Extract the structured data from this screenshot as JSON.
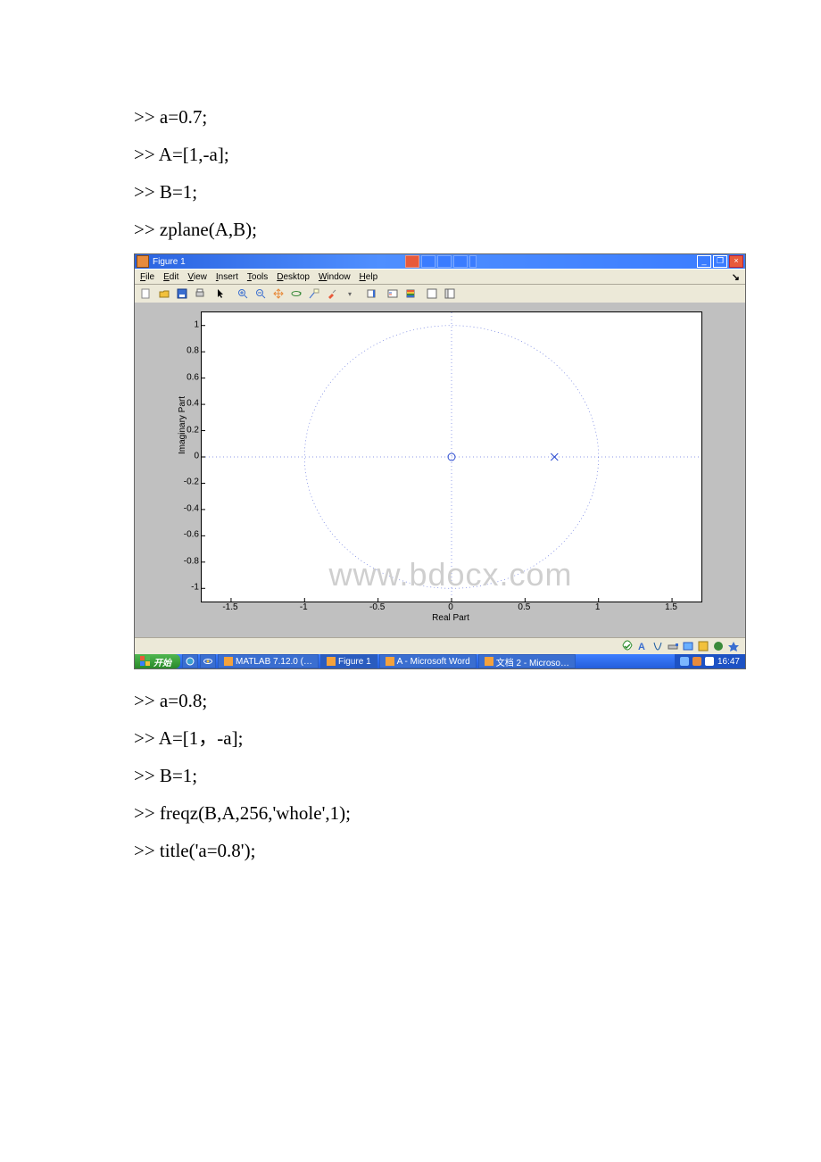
{
  "code_before": [
    ">> a=0.7;",
    ">> A=[1,-a];",
    ">> B=1;",
    ">> zplane(A,B);"
  ],
  "code_after": [
    ">> a=0.8;",
    ">> A=[1，-a];",
    ">> B=1;",
    ">> freqz(B,A,256,'whole',1);",
    ">> title('a=0.8');"
  ],
  "window": {
    "title": "Figure 1",
    "menus": [
      "File",
      "Edit",
      "View",
      "Insert",
      "Tools",
      "Desktop",
      "Window",
      "Help"
    ],
    "close_x": "×"
  },
  "taskbar": {
    "start": "开始",
    "items": [
      {
        "label": "MATLAB 7.12.0 (…"
      },
      {
        "label": "Figure 1",
        "active": true
      },
      {
        "label": "A - Microsoft Word"
      },
      {
        "label": "文档 2 - Microso…"
      }
    ],
    "clock": "16:47"
  },
  "watermark": "www.bdocx.com",
  "chart_data": {
    "type": "scatter",
    "title": "",
    "xlabel": "Real Part",
    "ylabel": "Imaginary Part",
    "xlim": [
      -1.7,
      1.7
    ],
    "ylim": [
      -1.1,
      1.1
    ],
    "xticks": [
      -1.5,
      -1,
      -0.5,
      0,
      0.5,
      1,
      1.5
    ],
    "yticks": [
      -1,
      -0.8,
      -0.6,
      -0.4,
      -0.2,
      0,
      0.2,
      0.4,
      0.6,
      0.8,
      1
    ],
    "unit_circle": true,
    "crosshair": true,
    "series": [
      {
        "name": "zeros",
        "marker": "o",
        "points": [
          {
            "x": 0,
            "y": 0
          }
        ]
      },
      {
        "name": "poles",
        "marker": "x",
        "points": [
          {
            "x": 0.7,
            "y": 0
          }
        ]
      }
    ]
  }
}
